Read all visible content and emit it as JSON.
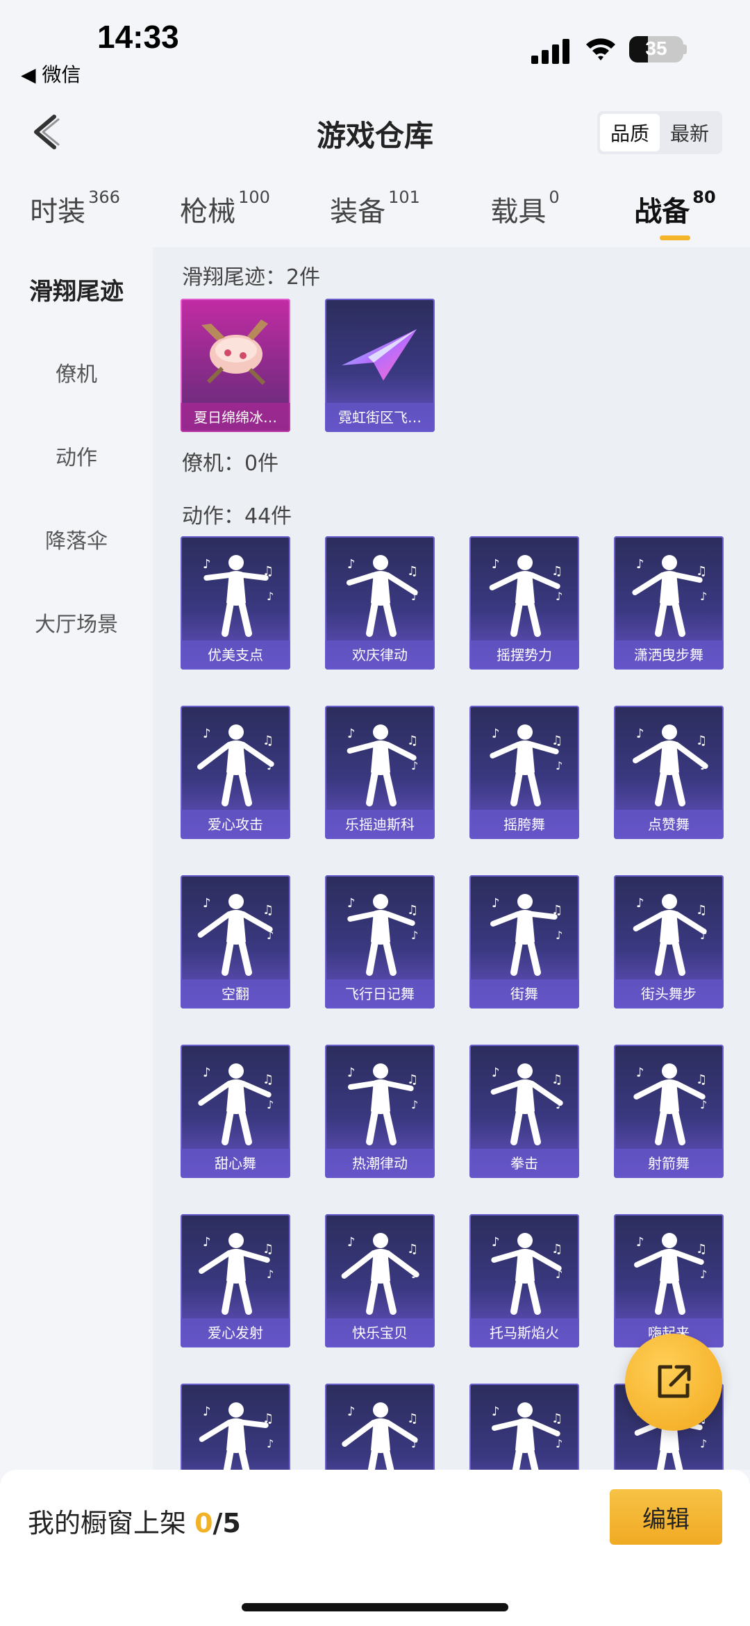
{
  "status_bar": {
    "time": "14:33",
    "back_app": "◀ 微信",
    "battery": "35",
    "battery_level": 0.35
  },
  "header": {
    "title": "游戏仓库",
    "sort_options": [
      "品质",
      "最新"
    ]
  },
  "tabs": [
    {
      "label": "时装",
      "count": "366"
    },
    {
      "label": "枪械",
      "count": "100"
    },
    {
      "label": "装备",
      "count": "101"
    },
    {
      "label": "载具",
      "count": "0"
    },
    {
      "label": "战备",
      "count": "80"
    }
  ],
  "sidebar": {
    "items": [
      "滑翔尾迹",
      "僚机",
      "动作",
      "降落伞",
      "大厅场景"
    ]
  },
  "sections": {
    "glide": "滑翔尾迹：2件",
    "wingman": "僚机：0件",
    "emotes": "动作：44件"
  },
  "glide_items": [
    "夏日绵绵冰…",
    "霓虹街区飞…"
  ],
  "emote_items": [
    "优美支点",
    "欢庆律动",
    "摇摆势力",
    "潇洒曳步舞",
    "爱心攻击",
    "乐摇迪斯科",
    "摇胯舞",
    "点赞舞",
    "空翻",
    "飞行日记舞",
    "街舞",
    "街头舞步",
    "甜心舞",
    "热潮律动",
    "拳击",
    "射箭舞",
    "爱心发射",
    "快乐宝贝",
    "托马斯焰火",
    "嗨起来"
  ],
  "bottom_bar": {
    "label": "我的橱窗上架 ",
    "count": "0",
    "total": "/5",
    "edit_label": "编辑"
  },
  "colors": {
    "accent": "#f2b227",
    "card_purple": "#3a3880",
    "card_pink": "#c22ca4"
  }
}
